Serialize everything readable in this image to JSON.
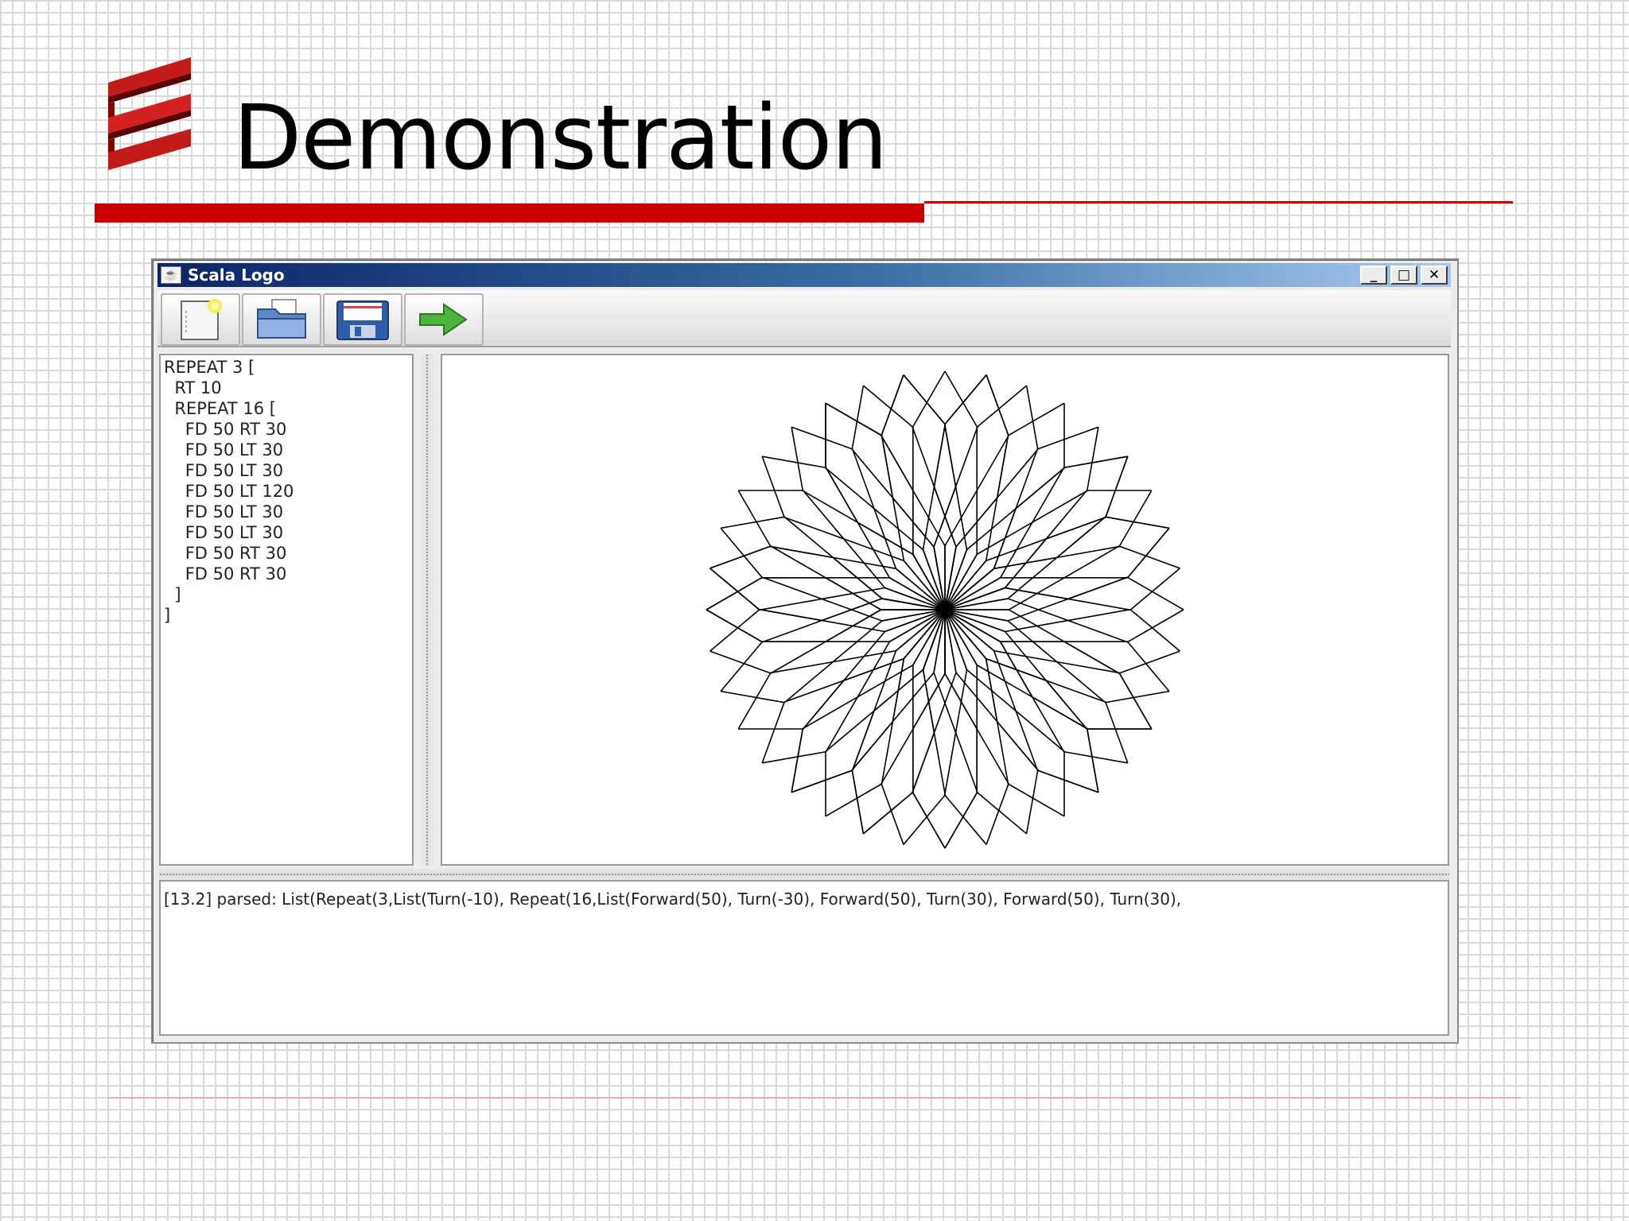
{
  "slide": {
    "title": "Demonstration",
    "accent_color": "#cc0000"
  },
  "window": {
    "title": "Scala Logo",
    "icon": "java-cup-icon",
    "controls": {
      "minimize": "_",
      "maximize": "□",
      "close": "✕"
    }
  },
  "toolbar": {
    "buttons": [
      {
        "name": "new-file-button",
        "icon": "new-document-icon"
      },
      {
        "name": "open-file-button",
        "icon": "open-folder-icon"
      },
      {
        "name": "save-file-button",
        "icon": "floppy-disk-icon"
      },
      {
        "name": "run-button",
        "icon": "green-arrow-right-icon"
      }
    ]
  },
  "editor": {
    "lines": [
      "REPEAT 3 [",
      "  RT 10",
      "  REPEAT 16 [",
      "    FD 50 RT 30",
      "    FD 50 LT 30",
      "    FD 50 LT 30",
      "    FD 50 LT 120",
      "    FD 50 LT 30",
      "    FD 50 LT 30",
      "    FD 50 RT 30",
      "    FD 50 RT 30",
      "  ]",
      "]"
    ]
  },
  "output": {
    "text": "[13.2] parsed: List(Repeat(3,List(Turn(-10), Repeat(16,List(Forward(50), Turn(-30), Forward(50), Turn(30), Forward(50), Turn(30),"
  }
}
